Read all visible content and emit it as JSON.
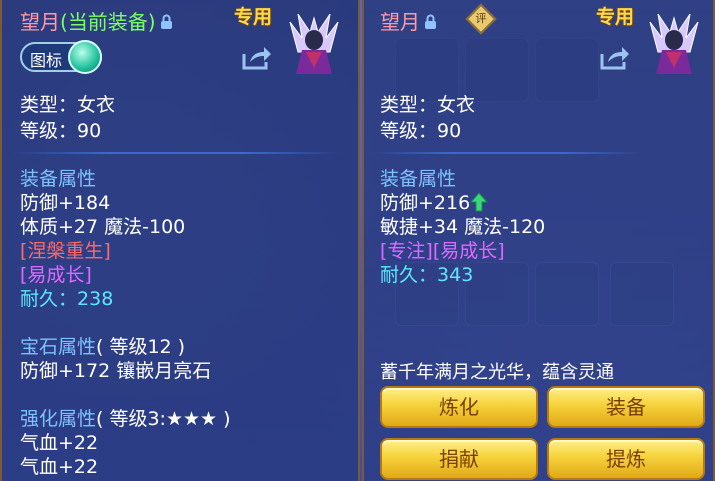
{
  "left": {
    "title_name": "望月",
    "title_current": "(当前装备)",
    "exclusive": "专用",
    "toggle_label": "图标",
    "type": "类型：女衣",
    "level": "等级：90",
    "equip_attr_heading": "装备属性",
    "defense": "防御+184",
    "stats": "体质+27 魔法-100",
    "special1": "[涅槃重生]",
    "special2": "[易成长]",
    "durability_label": "耐久：",
    "durability_value": "238",
    "gem_heading": "宝石属性",
    "gem_level": "( 等级12 )",
    "gem_effect": "防御+172 镶嵌月亮石",
    "enhance_heading": "强化属性",
    "enhance_level": "( 等级3:★★★ )",
    "enhance_line1": "气血+22",
    "enhance_line2": "气血+22"
  },
  "right": {
    "title_name": "望月",
    "rating_badge": "评",
    "exclusive": "专用",
    "type": "类型：女衣",
    "level": "等级：90",
    "equip_attr_heading": "装备属性",
    "defense": "防御+216",
    "stats": "敏捷+34 魔法-120",
    "special1": "[专注][易成长]",
    "durability_label": "耐久：",
    "durability_value": "343",
    "description": "蓄千年满月之光华，蕴含灵通",
    "buttons": {
      "refine": "炼化",
      "equip": "装备",
      "donate": "捐献",
      "extract": "提炼"
    }
  },
  "colors": {
    "panel": "#243476",
    "title_pink": "#ff9aa6",
    "title_green": "#7cff64",
    "section_blue": "#7cc2ff",
    "button_gold": "#f6d23a"
  }
}
